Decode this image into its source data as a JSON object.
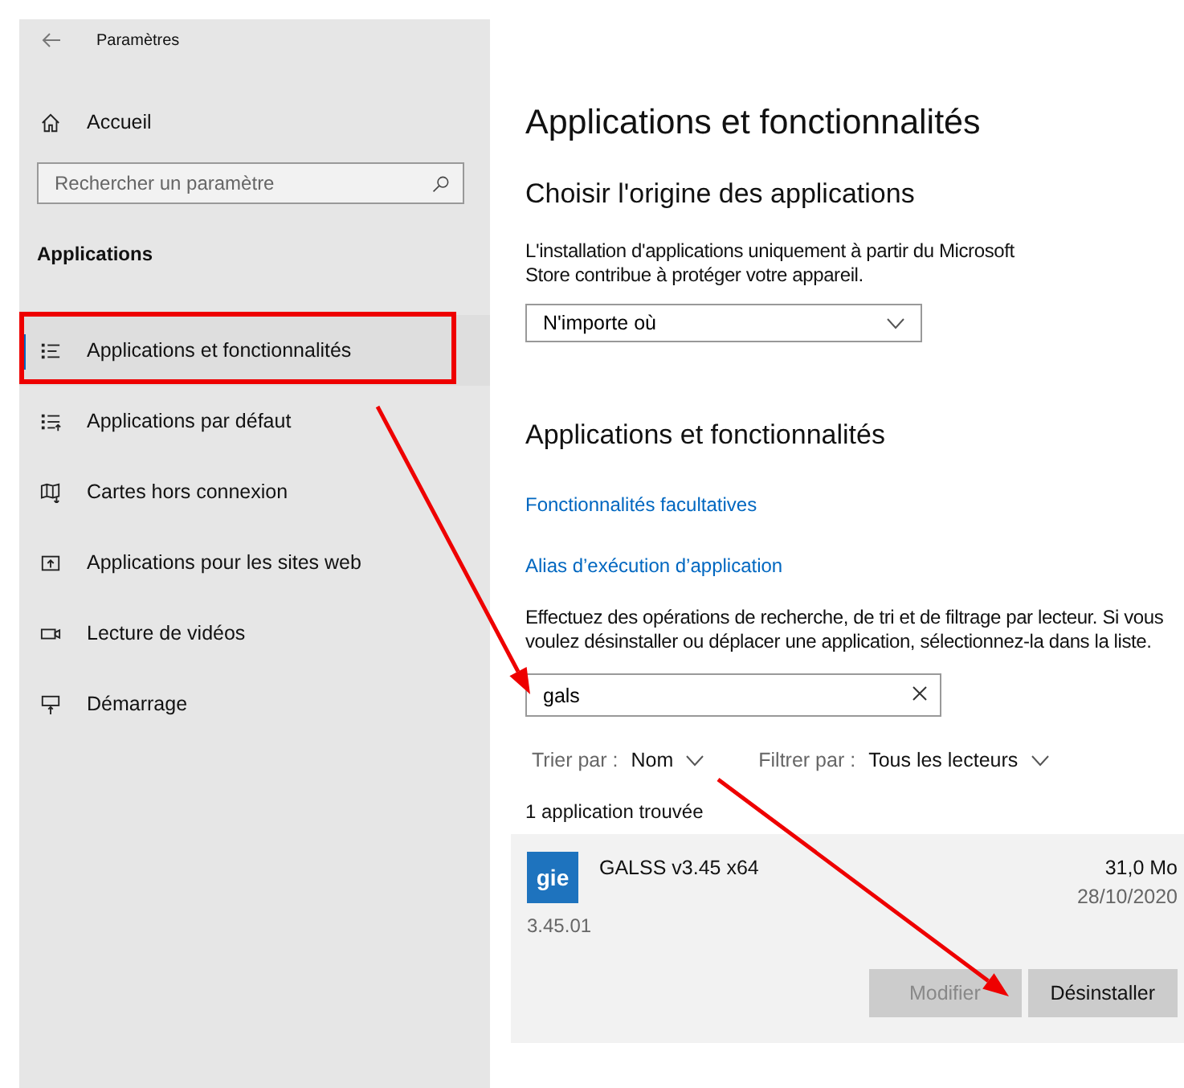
{
  "window": {
    "title": "Paramètres"
  },
  "sidebar": {
    "home": "Accueil",
    "search": {
      "placeholder": "Rechercher un paramètre"
    },
    "section": "Applications",
    "items": [
      {
        "label": "Applications et fonctionnalités",
        "selected": true
      },
      {
        "label": "Applications par défaut",
        "selected": false
      },
      {
        "label": "Cartes hors connexion",
        "selected": false
      },
      {
        "label": "Applications pour les sites web",
        "selected": false
      },
      {
        "label": "Lecture de vidéos",
        "selected": false
      },
      {
        "label": "Démarrage",
        "selected": false
      }
    ]
  },
  "content": {
    "title": "Applications et fonctionnalités",
    "origin": {
      "heading": "Choisir l'origine des applications",
      "description": "L'installation d'applications uniquement à partir du Microsoft Store contribue à protéger votre appareil.",
      "dropdown": "N'importe où"
    },
    "apps": {
      "heading": "Applications et fonctionnalités",
      "links": [
        "Fonctionnalités facultatives",
        "Alias d’exécution d’application"
      ],
      "description": "Effectuez des opérations de recherche, de tri et de filtrage par lecteur. Si vous voulez désinstaller ou déplacer une application, sélectionnez-la dans la liste.",
      "search": {
        "value": "gals"
      },
      "sort": {
        "label": "Trier par :",
        "value": "Nom"
      },
      "filter": {
        "label": "Filtrer par :",
        "value": "Tous les lecteurs"
      },
      "count": "1 application trouvée",
      "list": [
        {
          "name": "GALSS v3.45 x64",
          "icon_text": "gie",
          "version": "3.45.01",
          "size": "31,0 Mo",
          "date": "28/10/2020",
          "buttons": [
            {
              "label": "Modifier",
              "disabled": true
            },
            {
              "label": "Désinstaller",
              "disabled": false
            }
          ]
        }
      ]
    }
  },
  "annotations": [
    {
      "kind": "box"
    },
    {
      "kind": "arrow"
    },
    {
      "kind": "arrow"
    }
  ]
}
